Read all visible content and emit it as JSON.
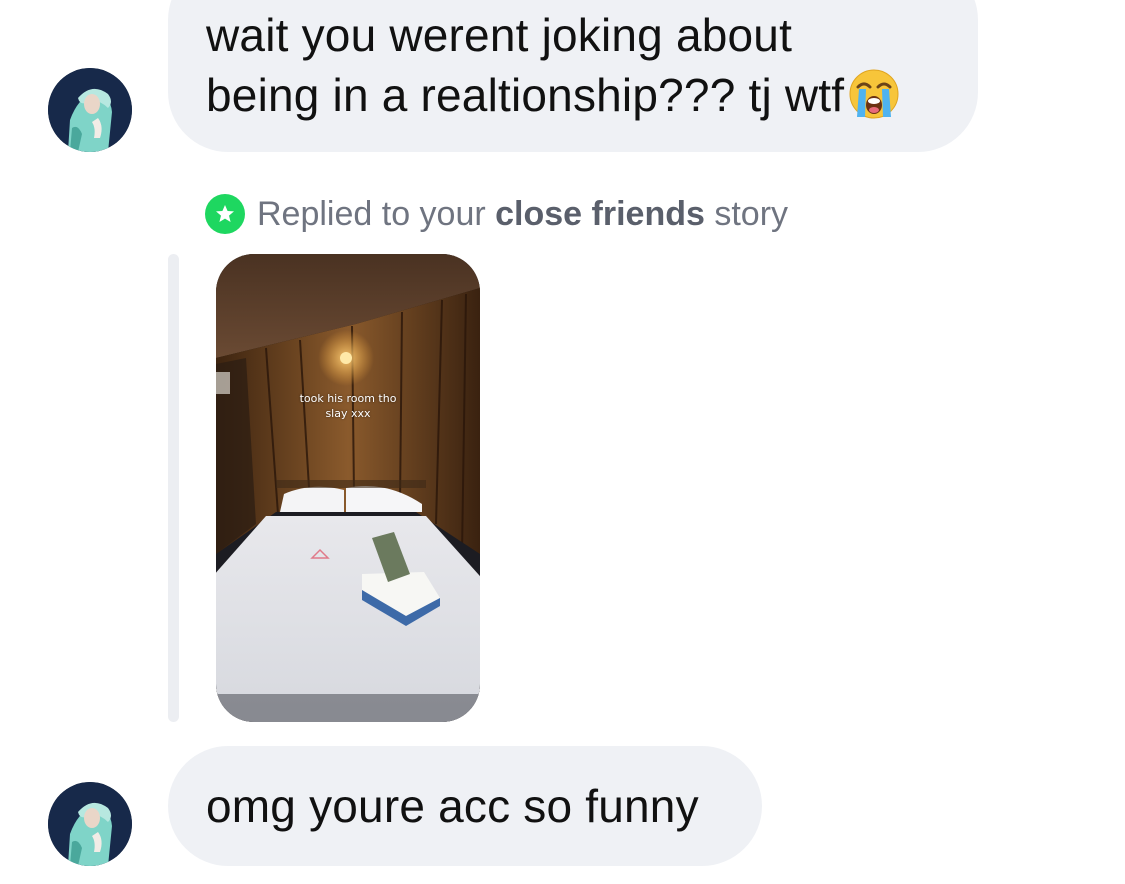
{
  "thread": {
    "messages": [
      {
        "text_line1": "wait you werent joking about",
        "text_line2": "being in a realtionship??? tj wtf",
        "emoji": "loudly-crying-face"
      },
      {
        "text": "omg youre acc so funny"
      }
    ],
    "reply": {
      "prefix": "Replied to your ",
      "highlight": "close friends",
      "suffix": " story",
      "badge_color": "#1ed760"
    },
    "story": {
      "caption_line1": "took his room tho",
      "caption_line2": "slay xxx"
    }
  },
  "colors": {
    "bubble": "#eff1f5",
    "reply_text": "#6f7480",
    "close_friends_green": "#1ed760"
  }
}
